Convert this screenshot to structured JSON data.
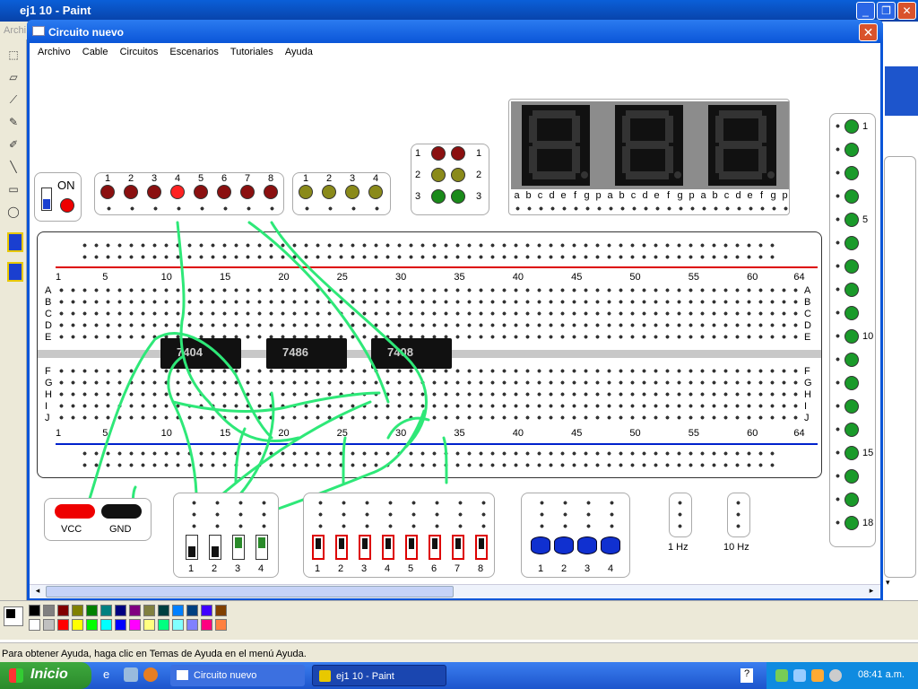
{
  "paint": {
    "title": "ej1 10 - Paint",
    "menu_peek": "Archi",
    "status": "Para obtener Ayuda, haga clic en Temas de Ayuda en el menú Ayuda.",
    "controls": {
      "minimize": "_",
      "maximize": "❐",
      "close": "✕"
    },
    "palette": [
      "#000000",
      "#808080",
      "#800000",
      "#808000",
      "#008000",
      "#008080",
      "#000080",
      "#800080",
      "#808040",
      "#004040",
      "#0080ff",
      "#004080",
      "#4000ff",
      "#804000",
      "#ffffff",
      "#c0c0c0",
      "#ff0000",
      "#ffff00",
      "#00ff00",
      "#00ffff",
      "#0000ff",
      "#ff00ff",
      "#ffff80",
      "#00ff80",
      "#80ffff",
      "#8080ff",
      "#ff0080",
      "#ff8040"
    ]
  },
  "circuit": {
    "title": "Circuito nuevo",
    "close": "✕",
    "menu": [
      "Archivo",
      "Cable",
      "Circuitos",
      "Escenarios",
      "Tutoriales",
      "Ayuda"
    ],
    "power_label": "ON",
    "red_leds": [
      "1",
      "2",
      "3",
      "4",
      "5",
      "6",
      "7",
      "8"
    ],
    "yellow_leds": [
      "1",
      "2",
      "3",
      "4"
    ],
    "traffic_labels": [
      "1",
      "2",
      "3"
    ],
    "segment_labels": [
      "a",
      "b",
      "c",
      "d",
      "e",
      "f",
      "g",
      "p"
    ],
    "green_led_labels": [
      "1",
      "5",
      "10",
      "15",
      "18"
    ],
    "column_numbers": [
      "1",
      "5",
      "10",
      "15",
      "20",
      "25",
      "30",
      "35",
      "40",
      "45",
      "50",
      "55",
      "60",
      "64"
    ],
    "rows_top": [
      "A",
      "B",
      "C",
      "D",
      "E"
    ],
    "rows_bottom": [
      "F",
      "G",
      "H",
      "I",
      "J"
    ],
    "chips": [
      "7404",
      "7486",
      "7408"
    ],
    "vcc": "VCC",
    "gnd": "GND",
    "switches": [
      "1",
      "2",
      "3",
      "4"
    ],
    "red_switches": [
      "1",
      "2",
      "3",
      "4",
      "5",
      "6",
      "7",
      "8"
    ],
    "buttons": [
      "1",
      "2",
      "3",
      "4"
    ],
    "clock1": "1 Hz",
    "clock10": "10 Hz"
  },
  "taskbar": {
    "start": "Inicio",
    "tasks": [
      "Circuito nuevo",
      "ej1 10 - Paint"
    ],
    "clock": "08:41 a.m."
  }
}
